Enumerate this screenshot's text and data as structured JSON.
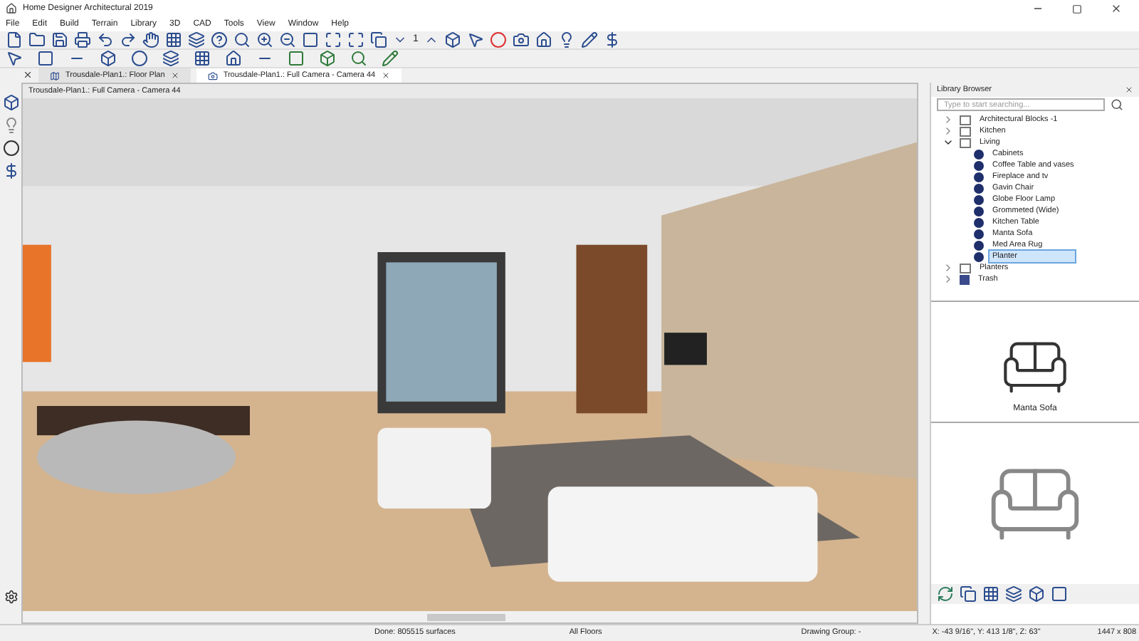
{
  "window": {
    "title": "Home Designer Architectural 2019"
  },
  "menu": [
    "File",
    "Edit",
    "Build",
    "Terrain",
    "Library",
    "3D",
    "CAD",
    "Tools",
    "View",
    "Window",
    "Help"
  ],
  "toolbar_text": "1",
  "tabs": [
    {
      "label": "Trousdale-Plan1.: Floor Plan",
      "selected": false,
      "kind": "plan"
    },
    {
      "label": "Trousdale-Plan1.: Full Camera - Camera 44",
      "selected": true,
      "kind": "camera"
    }
  ],
  "view": {
    "title": "Trousdale-Plan1.: Full Camera - Camera 44"
  },
  "library": {
    "title": "Library Browser",
    "search": {
      "placeholder": "Type to start searching..."
    },
    "tree": [
      {
        "label": "Architectural Blocks -1",
        "kind": "folder",
        "expanded": false,
        "selected": false
      },
      {
        "label": "Kitchen",
        "kind": "folder",
        "expanded": false,
        "selected": false
      },
      {
        "label": "Living",
        "kind": "folder",
        "expanded": true,
        "selected": false,
        "children": [
          {
            "label": "Cabinets",
            "kind": "item",
            "selected": false
          },
          {
            "label": "Coffee Table and vases",
            "kind": "item",
            "selected": false
          },
          {
            "label": "Fireplace and tv",
            "kind": "item",
            "selected": false
          },
          {
            "label": "Gavin Chair",
            "kind": "item",
            "selected": false
          },
          {
            "label": "Globe Floor Lamp",
            "kind": "item",
            "selected": false
          },
          {
            "label": "Grommeted (Wide)",
            "kind": "item",
            "selected": false
          },
          {
            "label": "Kitchen Table",
            "kind": "item",
            "selected": false
          },
          {
            "label": "Manta Sofa",
            "kind": "item",
            "selected": false
          },
          {
            "label": "Med Area Rug",
            "kind": "item",
            "selected": false
          },
          {
            "label": "Planter",
            "kind": "item",
            "selected": true
          }
        ]
      },
      {
        "label": "Planters",
        "kind": "folder",
        "expanded": false,
        "selected": false
      },
      {
        "label": "Trash",
        "kind": "trash",
        "expanded": false,
        "selected": false
      }
    ],
    "preview_caption": "Manta Sofa"
  },
  "status_bar": [
    "Done: 805515 surfaces",
    "All Floors",
    "Drawing Group: -",
    "X: -43 9/16\", Y: 413 1/8\", Z: 63\"",
    "1447 x 808"
  ]
}
